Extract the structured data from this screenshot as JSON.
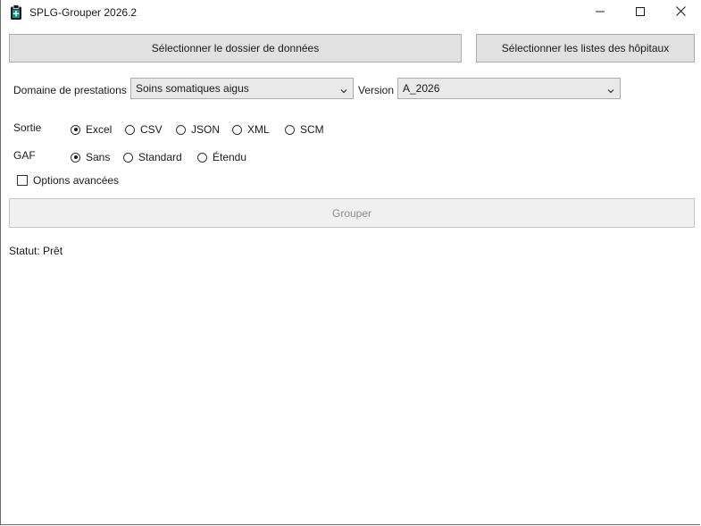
{
  "window": {
    "title": "SPLG-Grouper 2026.2",
    "app_icon": "clipboard-plus-icon",
    "controls": [
      "minimize-icon",
      "maximize-icon",
      "close-icon"
    ]
  },
  "buttons": {
    "select_data_folder": "Sélectionner le dossier de données",
    "select_hospital_lists": "Sélectionner les listes des hôpitaux",
    "grouper": "Grouper"
  },
  "domain": {
    "label": "Domaine de prestations",
    "value": "Soins somatiques aigus"
  },
  "version": {
    "label": "Version",
    "value": "A_2026"
  },
  "output": {
    "label": "Sortie",
    "options": [
      "Excel",
      "CSV",
      "JSON",
      "XML",
      "SCM"
    ],
    "selected": "Excel"
  },
  "gaf": {
    "label": "GAF",
    "options": [
      "Sans",
      "Standard",
      "Étendu"
    ],
    "selected": "Sans"
  },
  "advanced_options": {
    "label": "Options avancées",
    "checked": false
  },
  "status": "Statut: Prêt",
  "colors": {
    "button_bg": "#e1e1e1",
    "button_border": "#adadad",
    "disabled_text": "#8c8c8c",
    "icon_accent": "#1a8a8a"
  }
}
